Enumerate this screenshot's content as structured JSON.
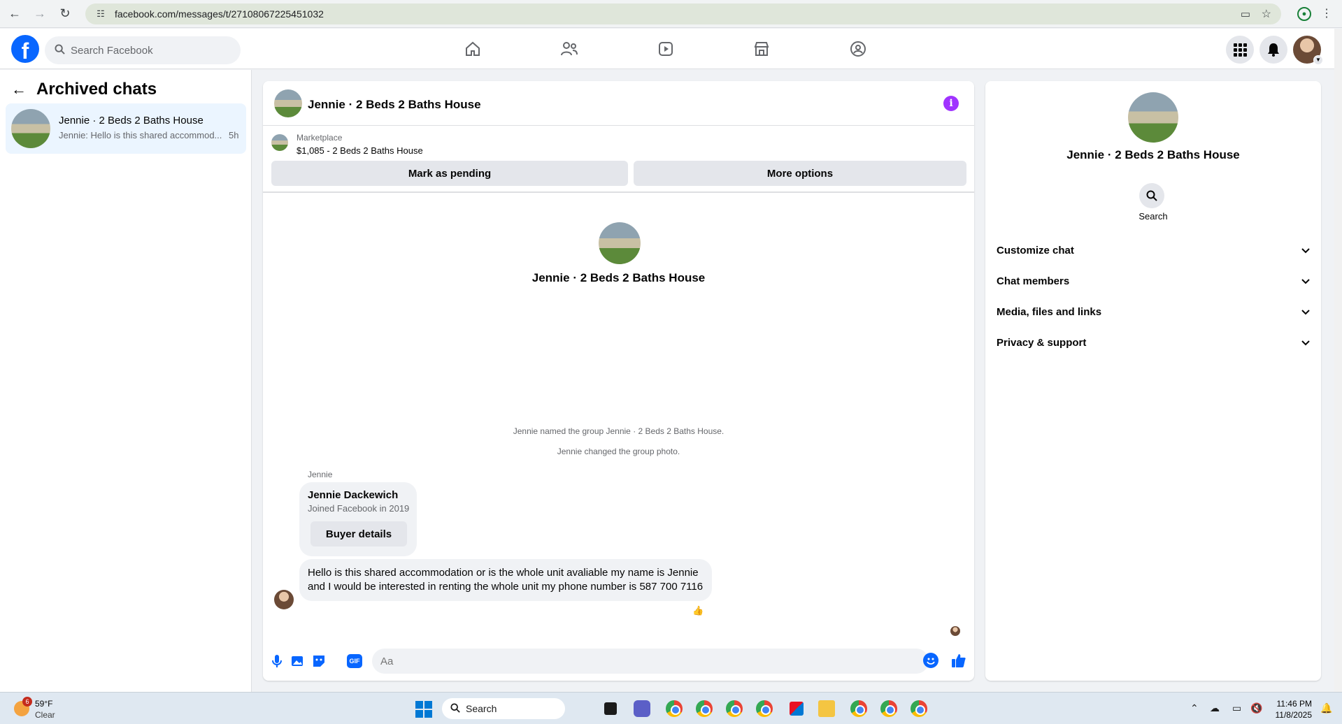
{
  "browser": {
    "url": "facebook.com/messages/t/27108067225451032"
  },
  "fb_nav": {
    "search_placeholder": "Search Facebook"
  },
  "left": {
    "title": "Archived chats",
    "chat": {
      "name": "Jennie · 2 Beds 2 Baths House",
      "preview": "Jennie: Hello is this shared accommod...",
      "time": "5h"
    }
  },
  "conversation": {
    "title": "Jennie · 2 Beds 2 Baths House",
    "marketplace_label": "Marketplace",
    "listing": "$1,085 - 2 Beds 2 Baths House",
    "mark_pending_label": "Mark as pending",
    "more_options_label": "More options",
    "center_name": "Jennie · 2 Beds 2 Baths House",
    "system_messages": [
      "Jennie named the group Jennie · 2 Beds 2 Baths House.",
      "Jennie changed the group photo."
    ],
    "sender": "Jennie",
    "buyer_name": "Jennie Dackewich",
    "buyer_joined": "Joined Facebook in 2019",
    "buyer_details_label": "Buyer details",
    "message": "Hello is this shared accommodation or is the whole unit avaliable my name is Jennie and I would be interested in renting the whole unit my phone number is 587 700 7116",
    "reaction": "👍",
    "composer_placeholder": "Aa"
  },
  "info_panel": {
    "name": "Jennie · 2 Beds 2 Baths House",
    "search_label": "Search",
    "sections": [
      "Customize chat",
      "Chat members",
      "Media, files and links",
      "Privacy & support"
    ]
  },
  "taskbar": {
    "weather_badge": "6",
    "temperature": "59°F",
    "condition": "Clear",
    "search_label": "Search",
    "time": "11:46 PM",
    "date": "11/8/2025"
  },
  "colors": {
    "fb_blue": "#0866ff",
    "info_purple": "#a033ff",
    "selected_row": "#ebf5ff"
  }
}
